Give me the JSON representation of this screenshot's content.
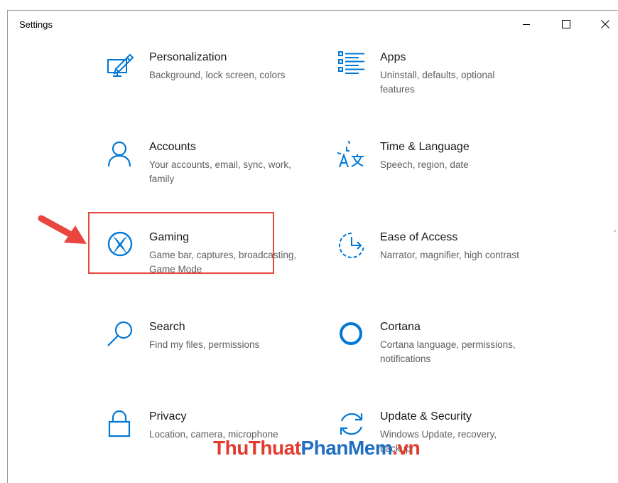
{
  "window": {
    "title": "Settings",
    "minimize": "minimize",
    "maximize": "maximize",
    "close": "close"
  },
  "colors": {
    "accent": "#0078d7",
    "highlight": "#e8463f"
  },
  "tiles": [
    {
      "name": "Personalization",
      "desc": "Background, lock screen, colors",
      "icon": "personalization-icon"
    },
    {
      "name": "Apps",
      "desc": "Uninstall, defaults, optional features",
      "icon": "apps-icon"
    },
    {
      "name": "Accounts",
      "desc": "Your accounts, email, sync, work, family",
      "icon": "accounts-icon"
    },
    {
      "name": "Time & Language",
      "desc": "Speech, region, date",
      "icon": "time-language-icon"
    },
    {
      "name": "Gaming",
      "desc": "Game bar, captures, broadcasting, Game Mode",
      "icon": "xbox-icon"
    },
    {
      "name": "Ease of Access",
      "desc": "Narrator, magnifier, high contrast",
      "icon": "ease-of-access-icon"
    },
    {
      "name": "Search",
      "desc": "Find my files, permissions",
      "icon": "search-icon"
    },
    {
      "name": "Cortana",
      "desc": "Cortana language, permissions, notifications",
      "icon": "cortana-icon"
    },
    {
      "name": "Privacy",
      "desc": "Location, camera, microphone",
      "icon": "lock-icon"
    },
    {
      "name": "Update & Security",
      "desc": "Windows Update, recovery, backup",
      "icon": "update-icon"
    }
  ],
  "watermark": {
    "part1": "ThuThuat",
    "part2": "PhanMem",
    "part3": ".vn"
  }
}
